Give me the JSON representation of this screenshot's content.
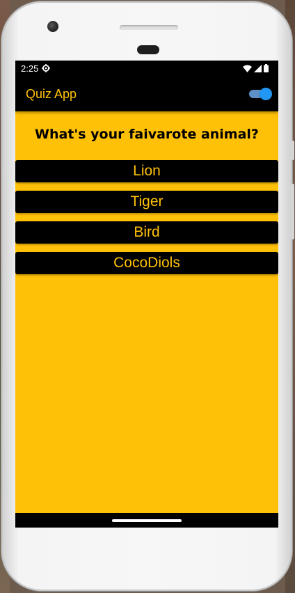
{
  "status_bar": {
    "time": "2:25"
  },
  "app_bar": {
    "title": "Quiz App",
    "theme_toggle_on": true
  },
  "quiz": {
    "question": "What's your faivarote animal?",
    "answers": [
      "Lion",
      "Tiger",
      "Bird",
      "CocoDiols"
    ]
  },
  "colors": {
    "background": "#ffc107",
    "bar": "#000000",
    "accent_text": "#ffc107",
    "toggle": "#2196f3"
  },
  "icons": {
    "status_settings": "gear-icon",
    "wifi": "wifi-icon",
    "signal": "signal-icon",
    "battery": "battery-icon"
  }
}
